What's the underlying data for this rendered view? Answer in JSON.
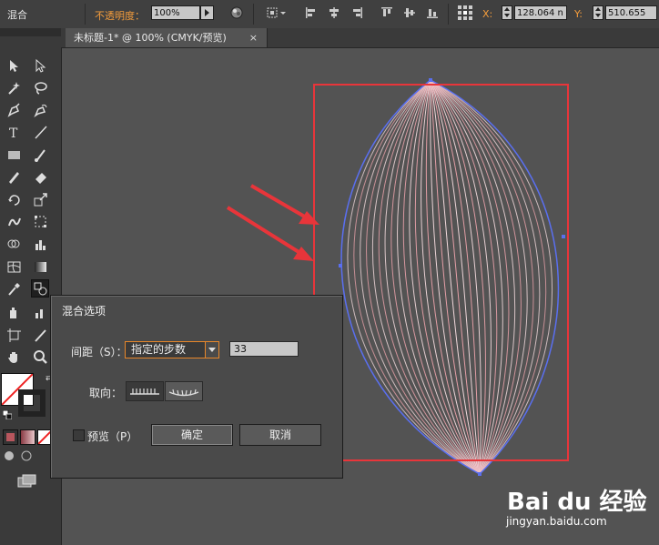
{
  "control_bar": {
    "mode": "混合",
    "opacity_label": "不透明度：",
    "opacity_value": "100%",
    "x_label": "X:",
    "x_value": "128.064 n",
    "y_label": "Y:",
    "y_value": "510.655"
  },
  "document_tab": {
    "title": "未标题-1* @ 100% (CMYK/预览)",
    "close": "×"
  },
  "dialog": {
    "title": "混合选项",
    "spacing_label": "间距（S）：",
    "spacing_option": "指定的步数",
    "steps_value": "33",
    "orientation_label": "取向：",
    "preview_label": "预览（P）",
    "ok_label": "确定",
    "cancel_label": "取消"
  },
  "watermark": {
    "logo": "Bai du 经验",
    "url": "jingyan.baidu.com"
  },
  "colors": {
    "annotation_red": "#e8353a",
    "path_blue": "#5a6ff0",
    "blend_pink": "#e6a0a8",
    "orange_label": "#f39c3c"
  }
}
